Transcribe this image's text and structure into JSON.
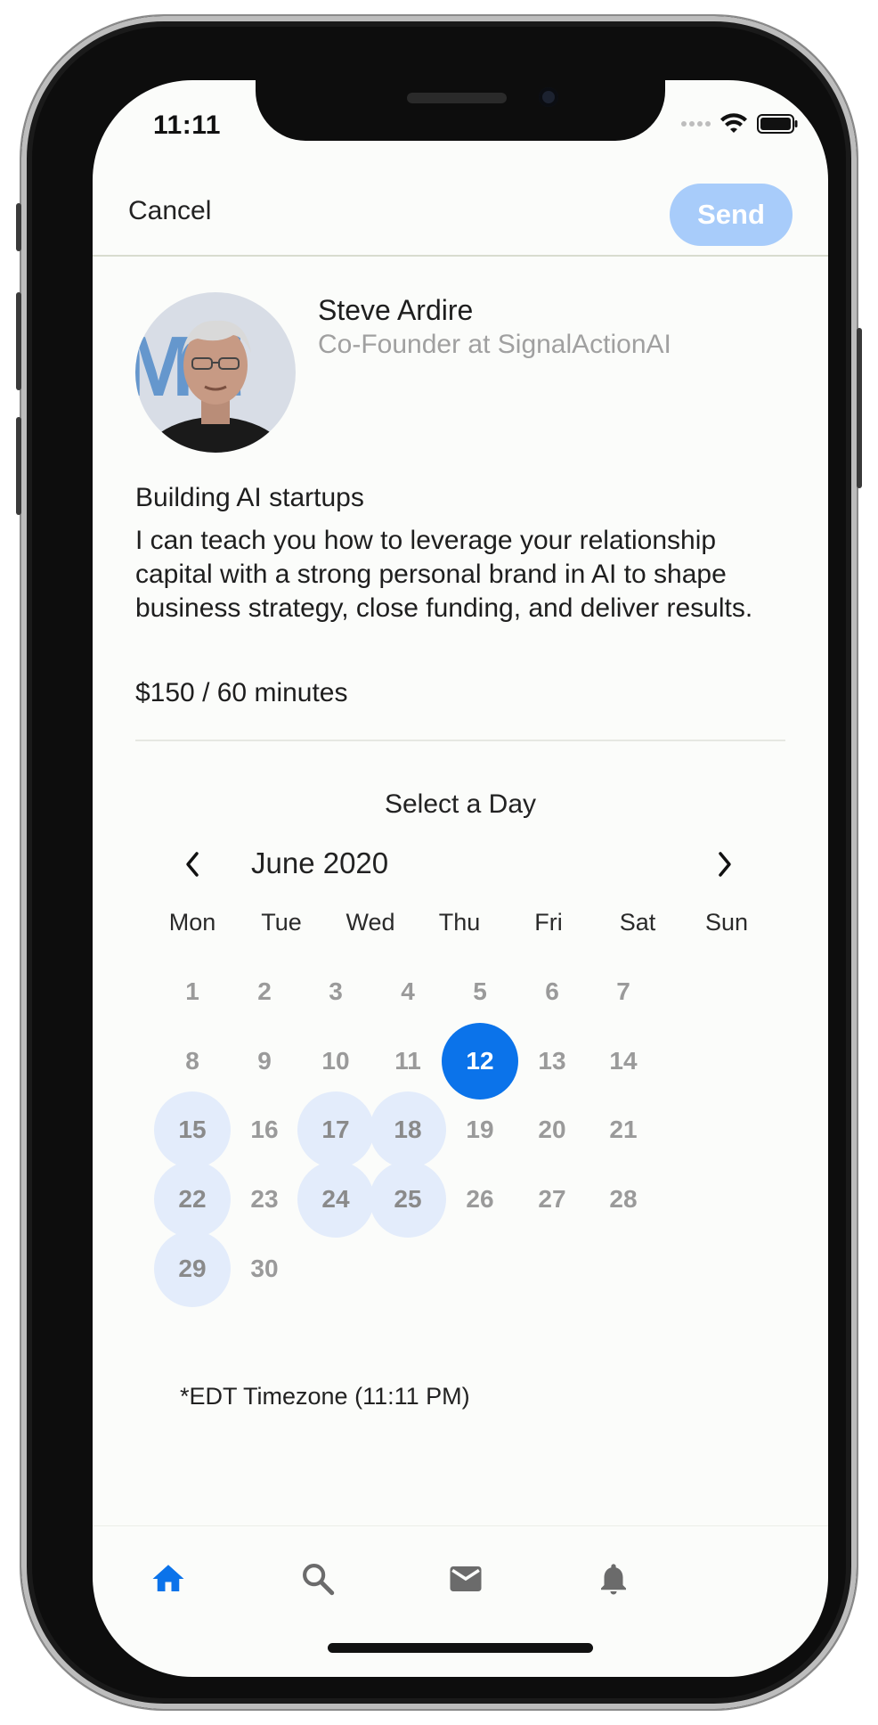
{
  "status_bar": {
    "time": "11:11"
  },
  "header": {
    "cancel_label": "Cancel",
    "send_label": "Send"
  },
  "profile": {
    "name": "Steve Ardire",
    "title": "Co-Founder at SignalActionAI",
    "heading": "Building AI startups",
    "description": "I can teach you how to leverage your relationship capital with a strong personal brand in AI to shape business strategy, close funding, and deliver results.",
    "price": "$150 / 60 minutes"
  },
  "calendar": {
    "title": "Select a Day",
    "month_label": "June 2020",
    "weekdays": [
      "Mon",
      "Tue",
      "Wed",
      "Thu",
      "Fri",
      "Sat",
      "Sun"
    ],
    "weeks": [
      [
        "1",
        "2",
        "3",
        "4",
        "5",
        "6",
        "7"
      ],
      [
        "8",
        "9",
        "10",
        "11",
        "12",
        "13",
        "14"
      ],
      [
        "15",
        "16",
        "17",
        "18",
        "19",
        "20",
        "21"
      ],
      [
        "22",
        "23",
        "24",
        "25",
        "26",
        "27",
        "28"
      ],
      [
        "29",
        "30"
      ]
    ],
    "selected_day": "12",
    "available_days": [
      "15",
      "17",
      "18",
      "22",
      "24",
      "25",
      "29"
    ],
    "timezone_note": "*EDT Timezone (11:11 PM)"
  },
  "tab_bar": {
    "tabs": [
      {
        "icon": "home-icon",
        "active": true
      },
      {
        "icon": "search-icon",
        "active": false
      },
      {
        "icon": "mail-icon",
        "active": false
      },
      {
        "icon": "bell-icon",
        "active": false
      }
    ]
  },
  "colors": {
    "accent": "#0b73ea",
    "send_disabled": "#a8ccfa",
    "available_day": "#e3ecfb",
    "inactive_icon": "#6b6b6b"
  }
}
